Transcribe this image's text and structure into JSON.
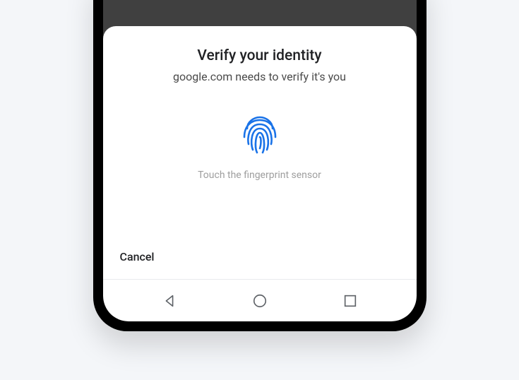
{
  "dialog": {
    "title": "Verify your identity",
    "subtitle": "google.com needs to verify it's you",
    "hint": "Touch the fingerprint sensor",
    "cancel_label": "Cancel"
  }
}
